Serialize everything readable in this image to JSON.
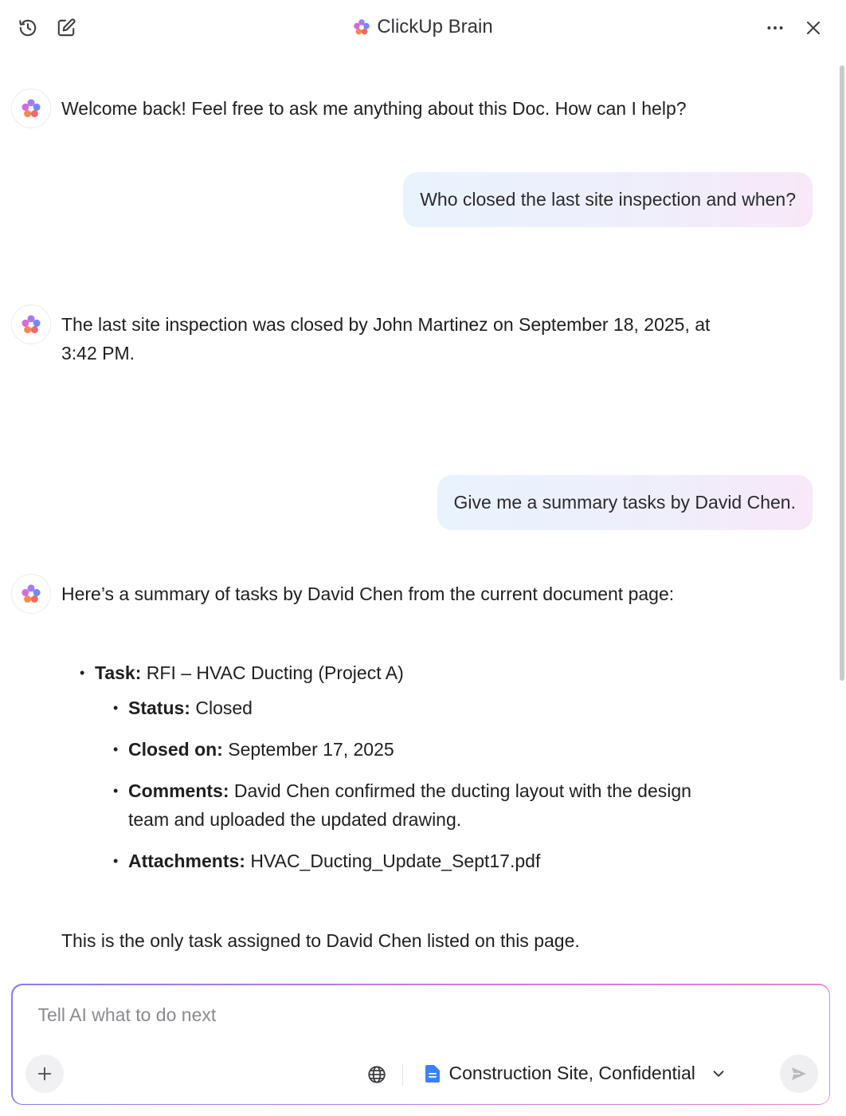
{
  "header": {
    "title": "ClickUp Brain",
    "left_icons": [
      "history-icon",
      "edit-icon"
    ],
    "right_icons": [
      "more-icon",
      "close-icon"
    ]
  },
  "messages": {
    "ai_welcome": "Welcome back! Feel free to ask me anything about this Doc. How can I help?",
    "user_1": "Who closed the last site inspection and when?",
    "ai_answer_1_line1": "The last site inspection was closed by John Martinez on September 18, 2025, at",
    "ai_answer_1_line2": "3:42 PM.",
    "user_2": "Give me a summary tasks by David Chen.",
    "ai_answer_2_intro": "Here’s a summary of tasks by David Chen from the current document page:",
    "task": {
      "task_label": "Task:",
      "task_value": "RFI – HVAC Ducting (Project A)",
      "status_label": "Status:",
      "status_value": "Closed",
      "closed_on_label": "Closed on:",
      "closed_on_value": "September 17, 2025",
      "comments_label": "Comments:",
      "comments_value_line1": "David Chen confirmed the ducting layout with the design",
      "comments_value_line2": "team and uploaded the updated drawing.",
      "attachments_label": "Attachments:",
      "attachments_value": "HVAC_Ducting_Update_Sept17.pdf"
    },
    "ai_answer_2_outro": "This is the only task assigned to David Chen listed on this page."
  },
  "composer": {
    "placeholder": "Tell AI what to do next",
    "value": "",
    "context_label": "Construction Site, Confidential"
  },
  "colors": {
    "bubble_gradient": [
      "#e8f3fd",
      "#f8e8f8"
    ],
    "composer_border": [
      "#8a7cf0",
      "#e584d8"
    ],
    "doc_icon": "#3b82f6"
  }
}
